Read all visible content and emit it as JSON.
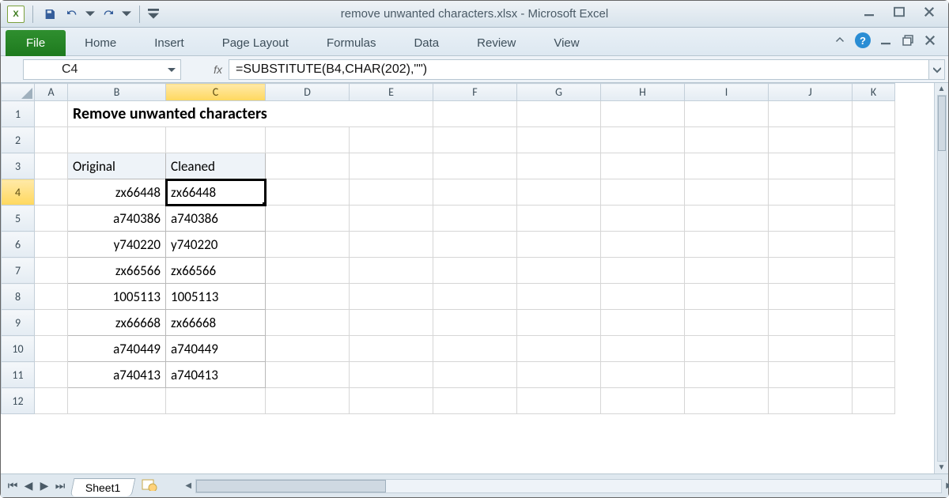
{
  "window": {
    "title": "remove unwanted characters.xlsx  -  Microsoft Excel"
  },
  "qat": {
    "save": "save-icon",
    "undo": "undo-icon",
    "redo": "redo-icon"
  },
  "ribbon": {
    "file": "File",
    "tabs": [
      "Home",
      "Insert",
      "Page Layout",
      "Formulas",
      "Data",
      "Review",
      "View"
    ]
  },
  "namebox": {
    "value": "C4"
  },
  "formula": {
    "label": "fx",
    "value": "=SUBSTITUTE(B4,CHAR(202),\"\")"
  },
  "columns": [
    "A",
    "B",
    "C",
    "D",
    "E",
    "F",
    "G",
    "H",
    "I",
    "J",
    "K"
  ],
  "selected": {
    "col": "C",
    "row": 4
  },
  "sheet": {
    "title_cell": "Remove unwanted characters",
    "headers": {
      "original": "Original",
      "cleaned": "Cleaned"
    },
    "rows": [
      {
        "original": "zx66448",
        "cleaned": "zx66448"
      },
      {
        "original": "a740386",
        "cleaned": "a740386"
      },
      {
        "original": "y740220",
        "cleaned": "y740220"
      },
      {
        "original": "zx66566",
        "cleaned": "zx66566"
      },
      {
        "original": "1005113",
        "cleaned": "1005113"
      },
      {
        "original": "zx66668",
        "cleaned": "zx66668"
      },
      {
        "original": "a740449",
        "cleaned": "a740449"
      },
      {
        "original": "a740413",
        "cleaned": "a740413"
      }
    ]
  },
  "sheet_tabs": {
    "active": "Sheet1"
  }
}
